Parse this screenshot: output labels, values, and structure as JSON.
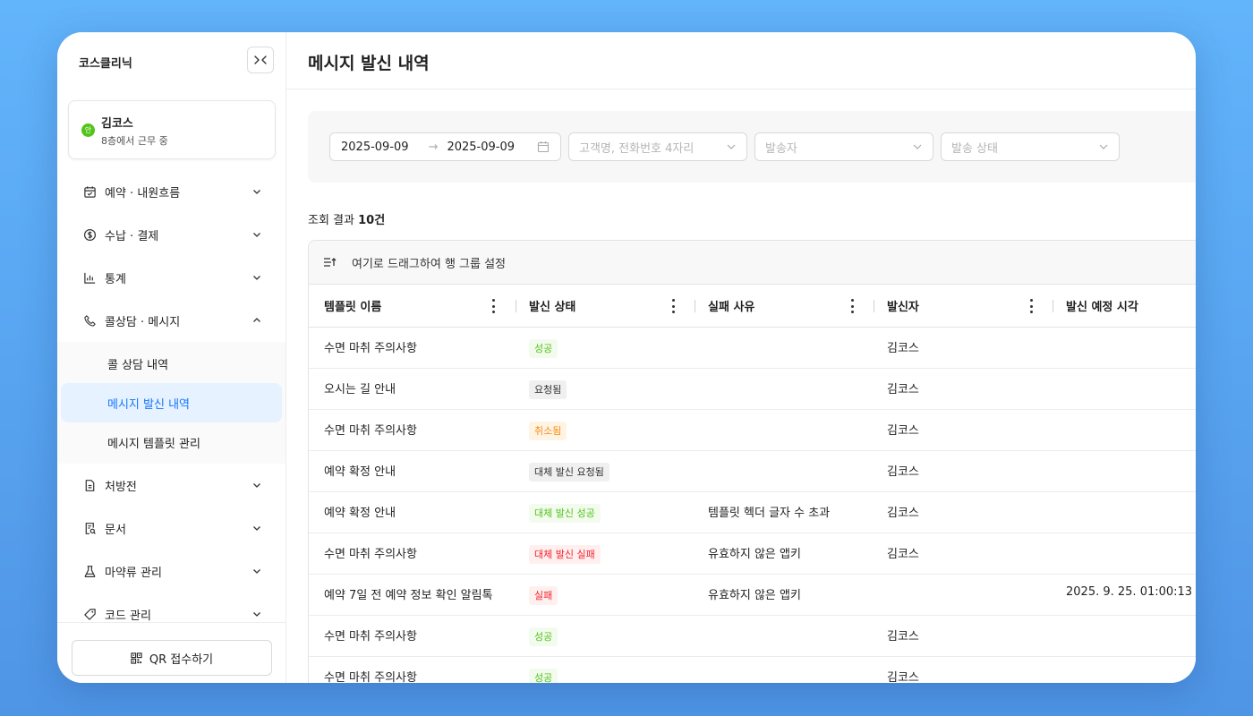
{
  "app": {
    "brand": "코스클리닉",
    "user": {
      "name": "김코스",
      "status": "8층에서 근무 중",
      "presence_badge": "안"
    }
  },
  "sidebar": {
    "items": [
      {
        "label": "예약 · 내원흐름",
        "icon": "calendar-icon",
        "expanded": false
      },
      {
        "label": "수납 · 결제",
        "icon": "dollar-icon",
        "expanded": false
      },
      {
        "label": "통계",
        "icon": "bar-chart-icon",
        "expanded": false
      },
      {
        "label": "콜상담 · 메시지",
        "icon": "phone-icon",
        "expanded": true,
        "children": [
          {
            "label": "콜 상담 내역"
          },
          {
            "label": "메시지 발신 내역",
            "active": true
          },
          {
            "label": "메시지 템플릿 관리"
          }
        ]
      },
      {
        "label": "처방전",
        "icon": "document-icon",
        "expanded": false
      },
      {
        "label": "문서",
        "icon": "file-search-icon",
        "expanded": false
      },
      {
        "label": "마약류 관리",
        "icon": "flask-icon",
        "expanded": false
      },
      {
        "label": "코드 관리",
        "icon": "tag-icon",
        "expanded": false
      }
    ],
    "footer_button": "QR 접수하기"
  },
  "page": {
    "title": "메시지 발신 내역"
  },
  "filters": {
    "date_from": "2025-09-09",
    "date_to": "2025-09-09",
    "customer_placeholder": "고객명, 전화번호 4자리",
    "sender_placeholder": "발송자",
    "status_placeholder": "발송 상태"
  },
  "results": {
    "prefix": "조회 결과 ",
    "count": "10건"
  },
  "grid": {
    "group_panel": "여기로 드래그하여 행 그룹 설정",
    "columns": [
      "템플릿 이름",
      "발신 상태",
      "실패 사유",
      "발신자",
      "발신 예정 시각"
    ],
    "rows": [
      {
        "template": "수면 마취 주의사항",
        "status": "성공",
        "status_kind": "success",
        "reason": "",
        "sender": "김코스",
        "scheduled": ""
      },
      {
        "template": "오시는 길 안내",
        "status": "요청됨",
        "status_kind": "neutral",
        "reason": "",
        "sender": "김코스",
        "scheduled": ""
      },
      {
        "template": "수면 마취 주의사항",
        "status": "취소됨",
        "status_kind": "warning",
        "reason": "",
        "sender": "김코스",
        "scheduled": ""
      },
      {
        "template": "예약 확정 안내",
        "status": "대체 발신 요청됨",
        "status_kind": "neutral",
        "reason": "",
        "sender": "김코스",
        "scheduled": ""
      },
      {
        "template": "예약 확정 안내",
        "status": "대체 발신 성공",
        "status_kind": "success",
        "reason": "템플릿 헥더 글자 수 초과",
        "sender": "김코스",
        "scheduled": ""
      },
      {
        "template": "수면 마취 주의사항",
        "status": "대체 발신 실패",
        "status_kind": "error",
        "reason": "유효하지 않은 앱키",
        "sender": "김코스",
        "scheduled": ""
      },
      {
        "template": "예약 7일 전 예약 정보 확인 알림톡",
        "status": "실패",
        "status_kind": "error",
        "reason": "유효하지 않은 앱키",
        "sender": "",
        "scheduled": "2025. 9. 25. 01:00:13"
      },
      {
        "template": "수면 마취 주의사항",
        "status": "성공",
        "status_kind": "success",
        "reason": "",
        "sender": "김코스",
        "scheduled": ""
      },
      {
        "template": "수면 마취 주의사항",
        "status": "성공",
        "status_kind": "success",
        "reason": "",
        "sender": "김코스",
        "scheduled": ""
      }
    ]
  },
  "colors": {
    "accent": "#1677ff",
    "active_bg": "#e6f2ff",
    "success": "#52c41a",
    "warning": "#fa8c16",
    "error": "#f5222d"
  }
}
